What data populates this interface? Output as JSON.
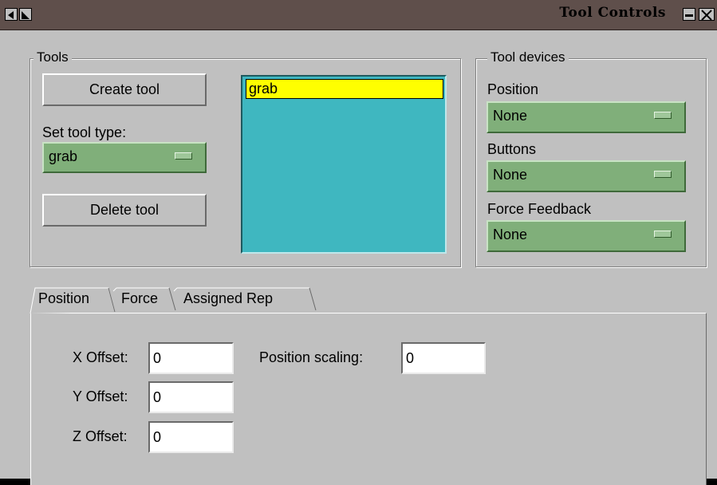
{
  "window": {
    "title": "Tool Controls"
  },
  "tools": {
    "label": "Tools",
    "create_button": "Create tool",
    "set_type_label": "Set tool type:",
    "tool_type_value": "grab",
    "delete_button": "Delete tool",
    "list_items": [
      "grab"
    ]
  },
  "devices": {
    "label": "Tool devices",
    "position_label": "Position",
    "position_value": "None",
    "buttons_label": "Buttons",
    "buttons_value": "None",
    "force_label": "Force Feedback",
    "force_value": "None"
  },
  "tabs": [
    {
      "label": "Position",
      "active": true
    },
    {
      "label": "Force",
      "active": false
    },
    {
      "label": "Assigned Rep",
      "active": false
    }
  ],
  "position_tab": {
    "x_label": "X Offset:",
    "x_value": "0",
    "y_label": "Y Offset:",
    "y_value": "0",
    "z_label": "Z Offset:",
    "z_value": "0",
    "scaling_label": "Position scaling:",
    "scaling_value": "0"
  }
}
